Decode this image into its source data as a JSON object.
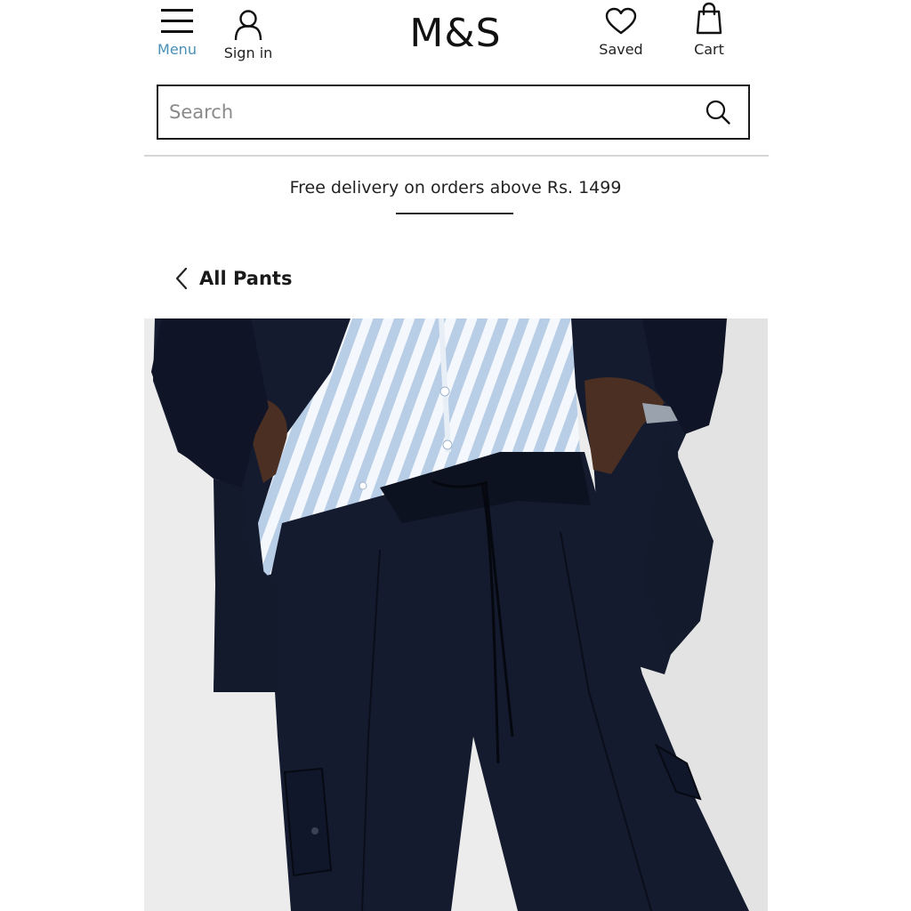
{
  "header": {
    "menu_label": "Menu",
    "signin_label": "Sign in",
    "logo_text": "M&S",
    "saved_label": "Saved",
    "cart_label": "Cart"
  },
  "search": {
    "placeholder": "Search",
    "value": ""
  },
  "promo": {
    "text": "Free delivery on orders above Rs. 1499"
  },
  "navigation": {
    "back_label": "All Pants"
  },
  "icons": {
    "menu": "hamburger-icon",
    "signin": "user-icon",
    "saved": "heart-icon",
    "cart": "shopping-bag-icon",
    "search": "search-icon",
    "back": "chevron-left-icon"
  },
  "colors": {
    "menu_accent": "#4a8fb5",
    "text": "#111111",
    "divider": "#d6d6d6",
    "product_navy": "#141b2e"
  }
}
